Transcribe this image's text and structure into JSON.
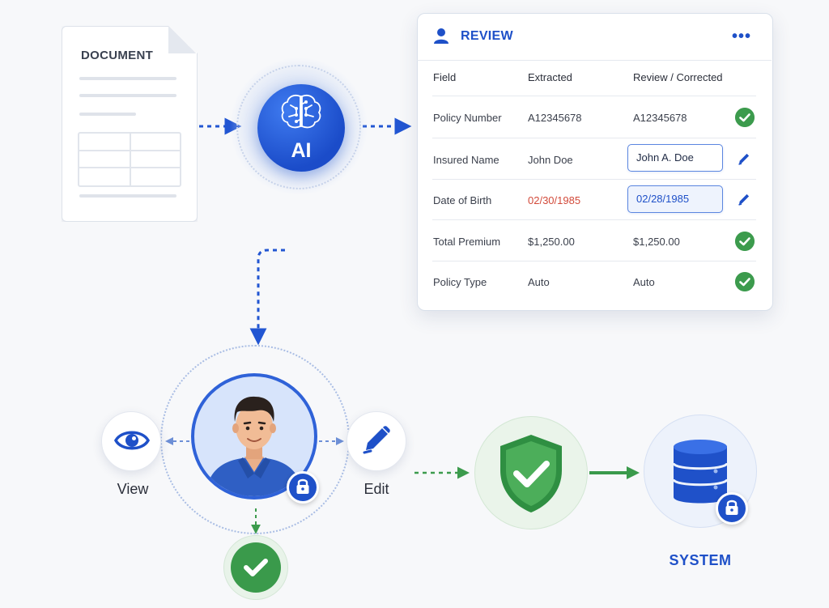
{
  "document": {
    "title": "DOCUMENT"
  },
  "ai": {
    "label": "AI"
  },
  "review": {
    "title": "REVIEW",
    "more_label": "•••",
    "columns": [
      "Field",
      "Extracted",
      "Review / Corrected"
    ],
    "rows": [
      {
        "field": "Policy Number",
        "extracted": "A12345678",
        "corrected": "A12345678",
        "status": "verified"
      },
      {
        "field": "Insured Name",
        "extracted": "John Doe",
        "corrected": "John A. Doe",
        "status": "edited"
      },
      {
        "field": "Date of Birth",
        "extracted": "02/30/1985",
        "corrected": "02/28/1985",
        "status": "edited"
      },
      {
        "field": "Total Premium",
        "extracted": "$1,250.00",
        "corrected": "$1,250.00",
        "status": "verified"
      },
      {
        "field": "Policy Type",
        "extracted": "Auto",
        "corrected": "Auto",
        "status": "verified"
      }
    ]
  },
  "actions": {
    "view": "View",
    "edit": "Edit"
  },
  "system": {
    "label": "SYSTEM"
  },
  "colors": {
    "primary": "#1e50c8",
    "success": "#3c9b4d",
    "error": "#d24a3a"
  },
  "icons": [
    "document-icon",
    "brain-icon",
    "user-icon",
    "ellipsis-icon",
    "check-icon",
    "pencil-icon",
    "eye-icon",
    "lock-icon",
    "shield-check-icon",
    "database-icon"
  ]
}
